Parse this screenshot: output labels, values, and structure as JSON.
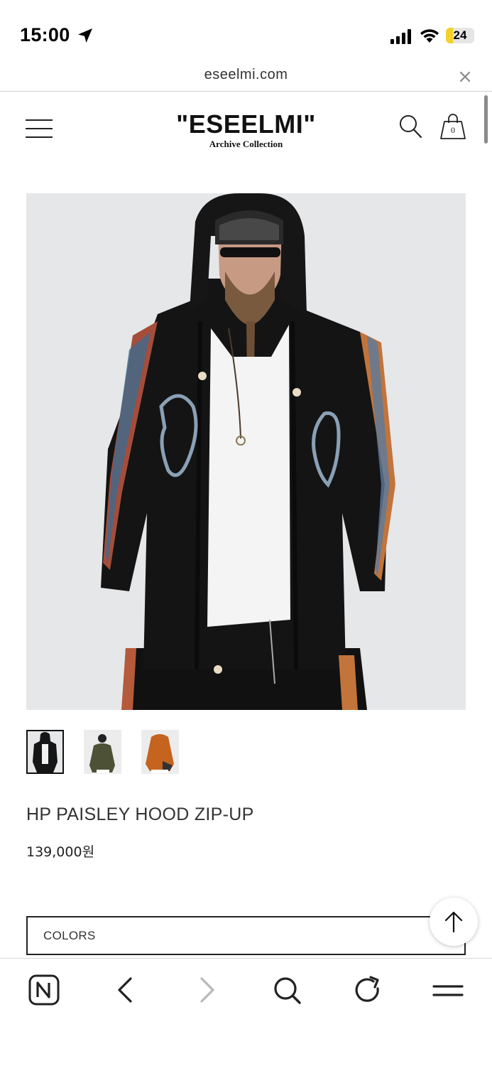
{
  "status_bar": {
    "time": "15:00",
    "battery": "24",
    "battery_level": 0.24,
    "icons": [
      "location-arrow-icon",
      "cellular-signal-icon",
      "wifi-icon",
      "battery-icon"
    ]
  },
  "browser": {
    "url": "eseelmi.com",
    "close_icon": "close-icon"
  },
  "header": {
    "logo": "\"ESEELMI\"",
    "logo_sub": "Archive Collection",
    "cart_count": "0",
    "icons": [
      "hamburger-menu-icon",
      "search-icon",
      "shopping-bag-icon"
    ]
  },
  "product": {
    "name": "HP PAISLEY HOOD ZIP-UP",
    "price": "139,000원",
    "thumbnail_count": 3,
    "selected_thumbnail": 1,
    "options_label": "COLORS"
  },
  "toolbar": {
    "icons": [
      "naver-home-icon",
      "back-icon",
      "forward-icon",
      "search-icon",
      "reload-icon",
      "menu-icon"
    ]
  },
  "colors": {
    "battery_fill": "#f2d22b",
    "image_background": "#e6e7e9",
    "text": "#333333"
  }
}
